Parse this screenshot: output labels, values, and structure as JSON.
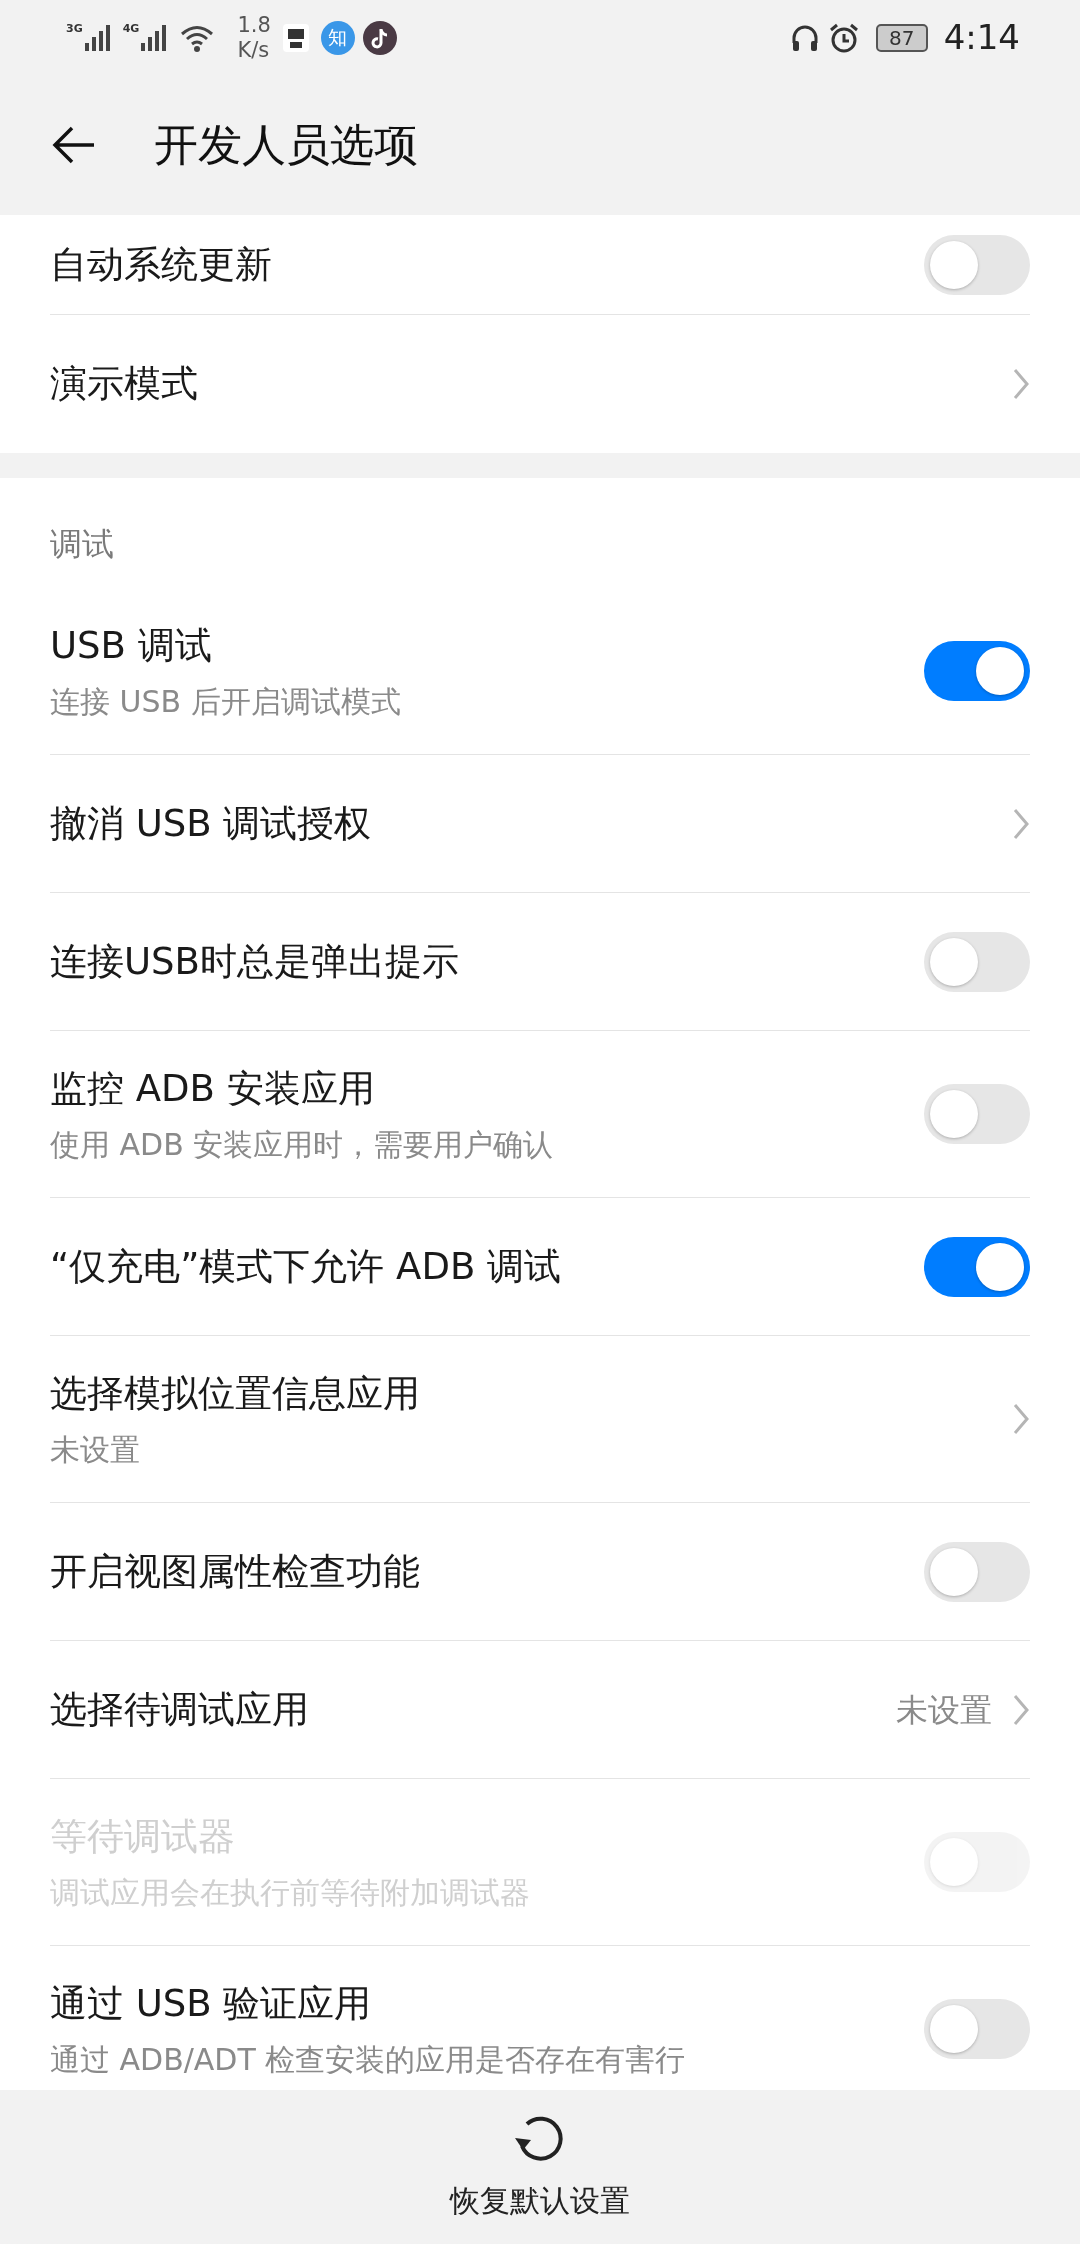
{
  "status_bar": {
    "network_1": "3G",
    "network_2": "4G",
    "speed_value": "1.8",
    "speed_unit": "K/s",
    "app_badge": "知",
    "battery": "87",
    "time": "4:14"
  },
  "header": {
    "title": "开发人员选项"
  },
  "top_items": [
    {
      "kind": "toggle",
      "title": "自动系统更新",
      "on": false,
      "disabled": false
    },
    {
      "kind": "chevron",
      "title": "演示模式"
    }
  ],
  "section": {
    "label": "调试",
    "items": [
      {
        "kind": "toggle",
        "title": "USB 调试",
        "subtitle": "连接 USB 后开启调试模式",
        "on": true,
        "disabled": false
      },
      {
        "kind": "chevron",
        "title": "撤消 USB 调试授权"
      },
      {
        "kind": "toggle",
        "title": "连接USB时总是弹出提示",
        "on": false,
        "disabled": false
      },
      {
        "kind": "toggle",
        "title": "监控 ADB 安装应用",
        "subtitle": "使用 ADB 安装应用时，需要用户确认",
        "on": false,
        "disabled": false
      },
      {
        "kind": "toggle",
        "title": "“仅充电”模式下允许 ADB 调试",
        "on": true,
        "disabled": false
      },
      {
        "kind": "chevron",
        "title": "选择模拟位置信息应用",
        "subtitle": "未设置"
      },
      {
        "kind": "toggle",
        "title": "开启视图属性检查功能",
        "on": false,
        "disabled": false
      },
      {
        "kind": "chevron",
        "title": "选择待调试应用",
        "value": "未设置"
      },
      {
        "kind": "toggle",
        "title": "等待调试器",
        "subtitle": "调试应用会在执行前等待附加调试器",
        "on": false,
        "disabled": true
      },
      {
        "kind": "toggle",
        "title": "通过 USB 验证应用",
        "subtitle": "通过 ADB/ADT 检查安装的应用是否存在有害行",
        "on": false,
        "disabled": false
      }
    ]
  },
  "bottom_action": {
    "label": "恢复默认设置"
  }
}
